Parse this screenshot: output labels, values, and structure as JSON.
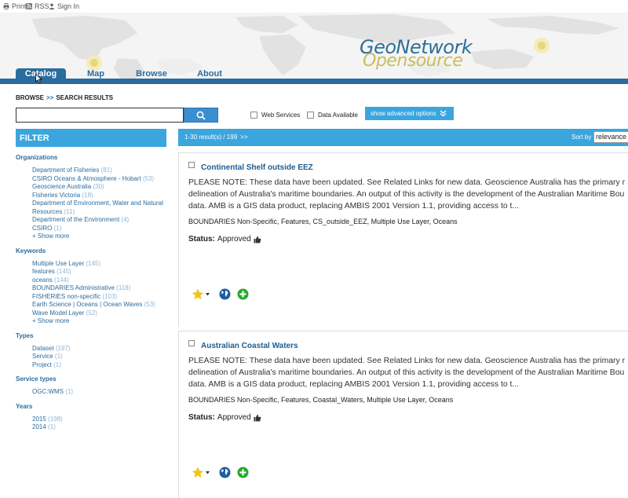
{
  "topbar": {
    "print_label": "Print",
    "rss_label": "RSS",
    "signin_label": "Sign In"
  },
  "logo": {
    "line1": "GeoNetwork",
    "line2": "Opensource"
  },
  "nav": {
    "tabs": [
      {
        "label": "Catalog",
        "active": true
      },
      {
        "label": "Map",
        "active": false
      },
      {
        "label": "Browse",
        "active": false
      },
      {
        "label": "About",
        "active": false
      }
    ]
  },
  "breadcrumb": {
    "root": "BROWSE",
    "separator": ">>",
    "current": "SEARCH RESULTS"
  },
  "search": {
    "value": "",
    "web_services_label": "Web Services",
    "data_available_label": "Data Available",
    "advanced_label": "show advanced options"
  },
  "filter": {
    "title": "FILTER",
    "groups": [
      {
        "title": "Organizations",
        "items": [
          {
            "label": "Department of Fisheries",
            "count": "(81)"
          },
          {
            "label": "CSIRO Oceans & Atmosphere - Hobart",
            "count": "(53)"
          },
          {
            "label": "Geoscience Australia",
            "count": "(30)"
          },
          {
            "label": "Fisheries Victoria",
            "count": "(18)"
          },
          {
            "label": "Department of Environment, Water and Natural Resources",
            "count": "(11)"
          },
          {
            "label": "Department of the Environment",
            "count": "(4)"
          },
          {
            "label": "CSIRO",
            "count": "(1)"
          }
        ],
        "more": "+ Show more"
      },
      {
        "title": "Keywords",
        "items": [
          {
            "label": "Multiple Use Layer",
            "count": "(145)"
          },
          {
            "label": "features",
            "count": "(145)"
          },
          {
            "label": "oceans",
            "count": "(144)"
          },
          {
            "label": "BOUNDARIES Administrative",
            "count": "(118)"
          },
          {
            "label": "FISHERIES non-specific",
            "count": "(103)"
          },
          {
            "label": "Earth Science | Oceans | Ocean Waves",
            "count": "(53)"
          },
          {
            "label": "Wave Model Layer",
            "count": "(52)"
          }
        ],
        "more": "+ Show more"
      },
      {
        "title": "Types",
        "items": [
          {
            "label": "Dataset",
            "count": "(197)"
          },
          {
            "label": "Service",
            "count": "(1)"
          },
          {
            "label": "Project",
            "count": "(1)"
          }
        ]
      },
      {
        "title": "Service types",
        "items": [
          {
            "label": "OGC:WMS",
            "count": "(1)"
          }
        ]
      },
      {
        "title": "Years",
        "items": [
          {
            "label": "2015",
            "count": "(198)"
          },
          {
            "label": "2014",
            "count": "(1)"
          }
        ]
      }
    ]
  },
  "results": {
    "count_label": "1-30 result(s) / 199",
    "next_label": ">>",
    "sort_label": "Sort by",
    "sort_value": "relevance",
    "items": [
      {
        "title": "Continental Shelf outside EEZ",
        "abstract_lines": [
          "PLEASE NOTE: These data have been updated. See Related Links for new data. Geoscience Australia has the primary r",
          "delineation of Australia's maritime boundaries. An output of this activity is the development of the Australian Maritime Bou",
          "data. AMB is a GIS data product, replacing AMBIS 2001 Version 1.1, providing access to t..."
        ],
        "keywords": "BOUNDARIES Non-Specific, Features, CS_outside_EEZ, Multiple Use Layer, Oceans",
        "status_label": "Status:",
        "status_value": "Approved"
      },
      {
        "title": "Australian Coastal Waters",
        "abstract_lines": [
          "PLEASE NOTE: These data have been updated. See Related Links for new data. Geoscience Australia has the primary r",
          "delineation of Australia's maritime boundaries. An output of this activity is the development of the Australian Maritime Bou",
          "data. AMB is a GIS data product, replacing AMBIS 2001 Version 1.1, providing access to t..."
        ],
        "keywords": "BOUNDARIES Non-Specific, Features, Coastal_Waters, Multiple Use Layer, Oceans",
        "status_label": "Status:",
        "status_value": "Approved"
      }
    ]
  },
  "colors": {
    "brand_blue": "#2b6c9f",
    "accent_blue": "#3ba5dd",
    "logo_gold": "#c9be5a",
    "star": "#f0c419",
    "add": "#2aa82a"
  },
  "icons": [
    "printer-icon",
    "rss-icon",
    "user-icon",
    "search-icon",
    "chevron-double-down-icon",
    "thumbs-up-icon",
    "star-icon",
    "globe-icon",
    "plus-circle-icon",
    "mouse-cursor-icon"
  ]
}
